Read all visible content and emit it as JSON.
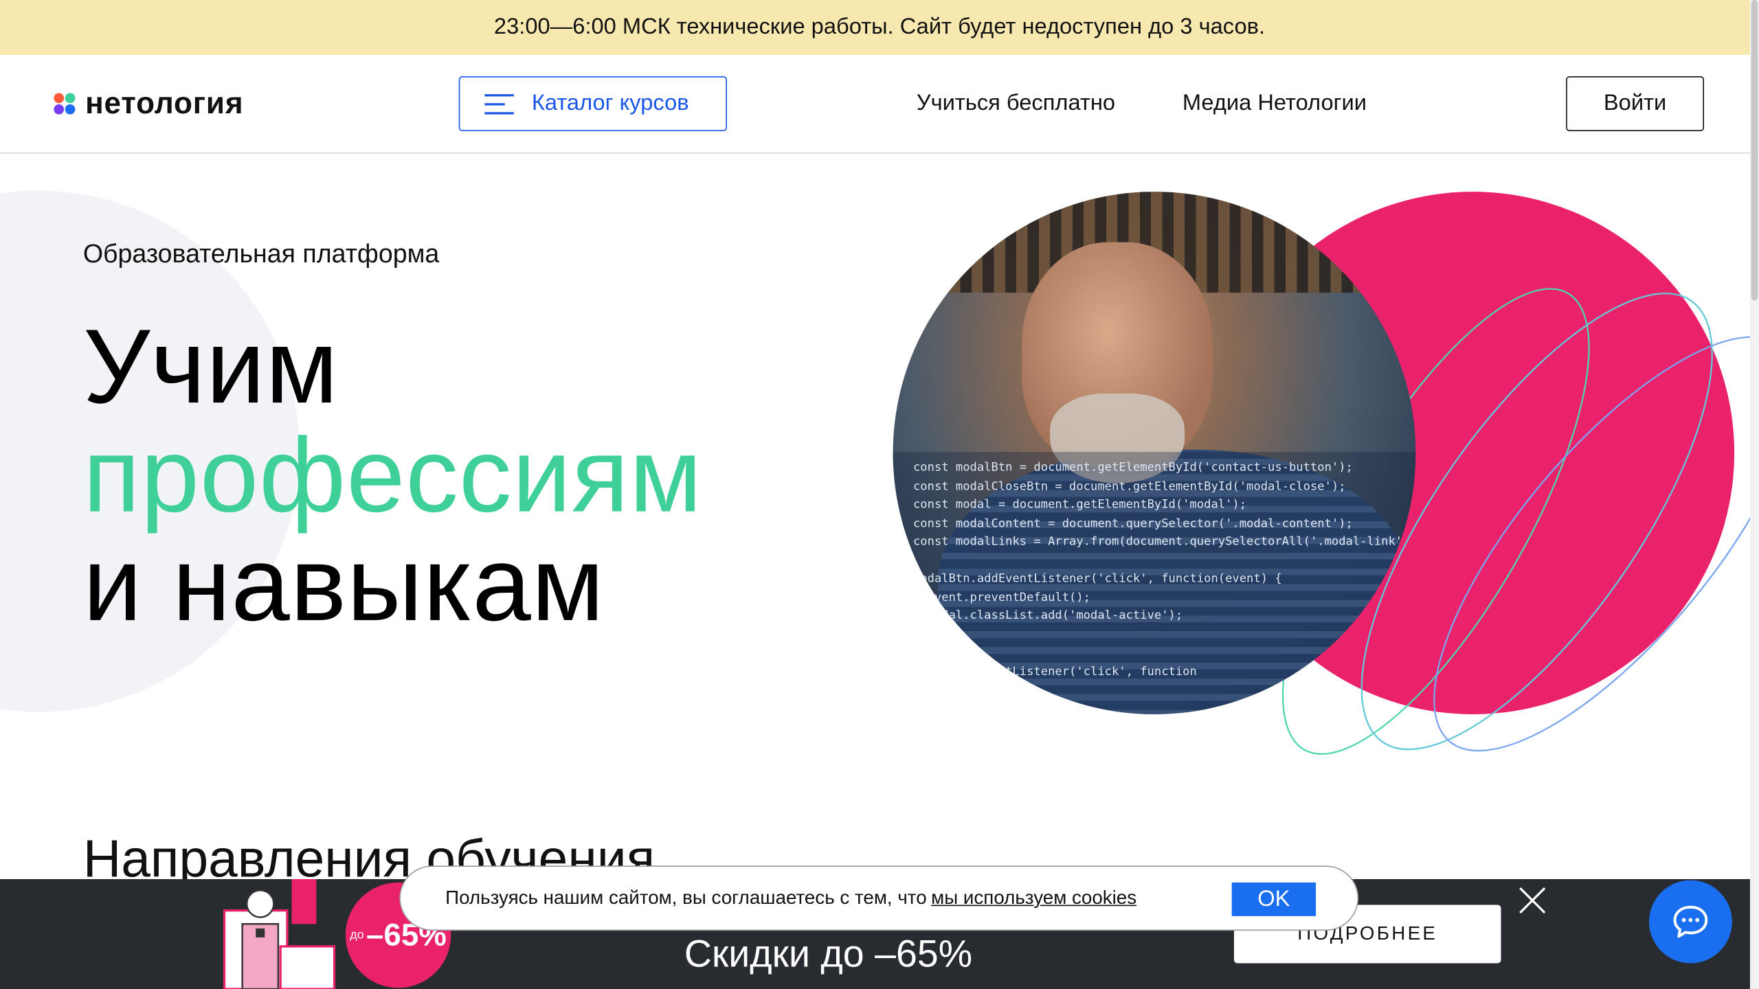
{
  "maintenance": {
    "text": "23:00—6:00 МСК технические работы. Сайт будет недоступен до 3 часов."
  },
  "header": {
    "logo_text": "нетология",
    "catalog_label": "Каталог курсов",
    "nav": [
      {
        "label": "Учиться бесплатно"
      },
      {
        "label": "Медиа Нетологии"
      }
    ],
    "login_label": "Войти"
  },
  "hero": {
    "eyebrow": "Образовательная платформа",
    "title_line1": "Учим",
    "title_line2": "профессиям",
    "title_line3": "и навыкам",
    "accent_color": "#3fd09a",
    "pink_color": "#ea216b",
    "code_lines": [
      "const modalBtn = document.getElementById('contact-us-button');",
      "const modalCloseBtn = document.getElementById('modal-close');",
      "const modal = document.getElementById('modal');",
      "const modalContent = document.querySelector('.modal-content');",
      "const modalLinks = Array.from(document.querySelectorAll('.modal-link');",
      "",
      "modalBtn.addEventListener('click', function(event) {",
      "  event.preventDefault();",
      "  modal.classList.add('modal-active');",
      "",
      "",
      "modal.addEventListener('click', function"
    ]
  },
  "section": {
    "title": "Направления обучения"
  },
  "promo": {
    "badge_prefix": "до",
    "badge_value": "–65%",
    "text": "Скидки до –65%",
    "more_label": "ПОДРОБНЕЕ",
    "close_icon": "close-icon"
  },
  "cookie": {
    "text": "Пользуясь нашим сайтом, вы соглашаетесь с тем, что",
    "link": "мы используем cookies",
    "ok_label": "OK"
  },
  "chat": {
    "icon": "chat-bubble-icon"
  }
}
